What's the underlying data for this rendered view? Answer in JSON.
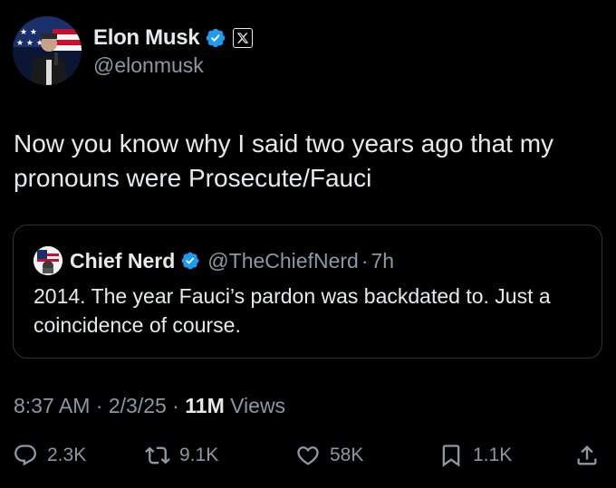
{
  "author": {
    "name": "Elon Musk",
    "handle": "@elonmusk",
    "verified": true,
    "affiliate_badge": "X"
  },
  "tweet": {
    "text": "Now you know why I said two years ago that my pronouns were Prosecute/Fauci"
  },
  "quoted_tweet": {
    "author_name": "Chief Nerd",
    "handle": "@TheChiefNerd",
    "separator": "·",
    "age": "7h",
    "text": "2014. The year Fauci’s pardon was backdated to. Just a coincidence of course."
  },
  "meta": {
    "time": "8:37 AM",
    "dot1": " · ",
    "date": "2/3/25",
    "dot2": " · ",
    "views_count": "11M",
    "views_label": " Views"
  },
  "actions": {
    "replies": "2.3K",
    "reposts": "9.1K",
    "likes": "58K",
    "bookmarks": "1.1K"
  },
  "colors": {
    "background": "#000000",
    "text": "#e7e9ea",
    "secondary": "#8b98a5",
    "verified": "#1d9bf0",
    "border": "#2f3336"
  }
}
